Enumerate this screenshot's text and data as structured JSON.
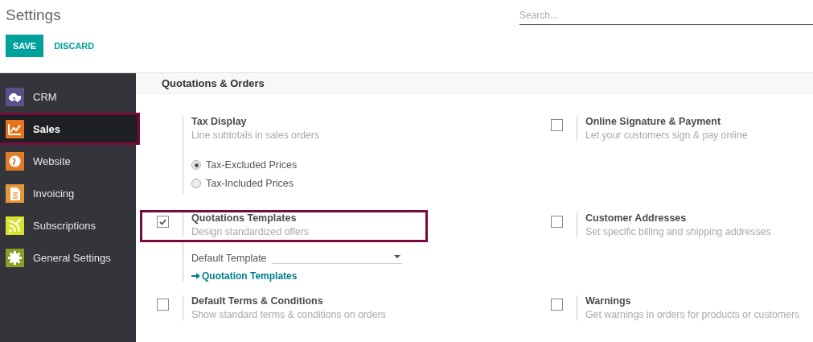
{
  "title": "Settings",
  "search": {
    "placeholder": "Search..."
  },
  "buttons": [
    {
      "label": "SAVE",
      "kind": "primary"
    },
    {
      "label": "DISCARD",
      "kind": "link"
    }
  ],
  "sidebar": {
    "items": [
      {
        "label": "CRM",
        "color": "#5b4f8a",
        "selected": false,
        "highlighted": false
      },
      {
        "label": "Sales",
        "color": "#e8731d",
        "selected": true,
        "highlighted": true
      },
      {
        "label": "Website",
        "color": "#e07b28",
        "selected": false,
        "highlighted": false
      },
      {
        "label": "Invoicing",
        "color": "#e8963a",
        "selected": false,
        "highlighted": false
      },
      {
        "label": "Subscriptions",
        "color": "#d6e22c",
        "selected": false,
        "highlighted": false
      },
      {
        "label": "General Settings",
        "color": "#8a9e22",
        "selected": false,
        "highlighted": false
      }
    ]
  },
  "section": {
    "title": "Quotations & Orders"
  },
  "rows": [
    {
      "left": {
        "kind": "plain",
        "title": "Tax Display",
        "description": "Line subtotals in sales orders",
        "highlighted": false,
        "options": [
          {
            "label": "Tax-Excluded Prices",
            "selected": true
          },
          {
            "label": "Tax-Included Prices",
            "selected": false
          }
        ]
      },
      "right": {
        "kind": "checkbox",
        "checked": false,
        "title": "Online Signature & Payment",
        "description": "Let your customers sign & pay online",
        "highlighted": false
      }
    },
    {
      "left": {
        "kind": "checkbox",
        "checked": true,
        "title": "Quotations Templates",
        "description": "Design standardized offers",
        "highlighted": true,
        "field": {
          "label": "Default Template"
        },
        "link": "Quotation Templates"
      },
      "right": {
        "kind": "checkbox",
        "checked": false,
        "title": "Customer Addresses",
        "description": "Set specific billing and shipping addresses",
        "highlighted": false
      }
    },
    {
      "left": {
        "kind": "checkbox",
        "checked": false,
        "title": "Default Terms & Conditions",
        "description": "Show standard terms & conditions on orders",
        "highlighted": false
      },
      "right": {
        "kind": "checkbox",
        "checked": false,
        "title": "Warnings",
        "description": "Get warnings in orders for products or customers",
        "highlighted": false
      }
    }
  ]
}
